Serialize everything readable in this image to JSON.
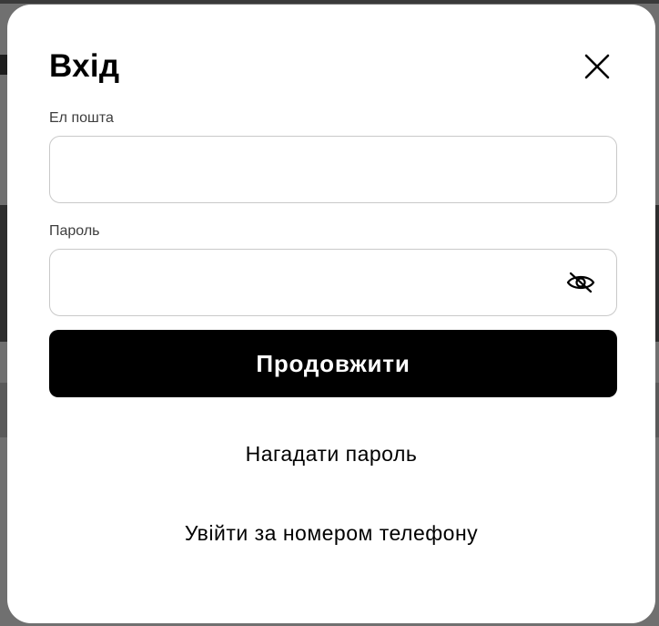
{
  "modal": {
    "title": "Вхід",
    "close_icon": "close-icon"
  },
  "form": {
    "email_label": "Ел пошта",
    "email_value": "",
    "password_label": "Пароль",
    "password_value": "",
    "password_toggle_icon": "eye-slash-icon",
    "submit_label": "Продовжити"
  },
  "links": {
    "remind_password": "Нагадати пароль",
    "phone_login": "Увійти за номером телефону"
  },
  "colors": {
    "overlay": "#707070",
    "modal_bg": "#ffffff",
    "primary_button": "#000000",
    "input_border": "#c9c9c9"
  }
}
